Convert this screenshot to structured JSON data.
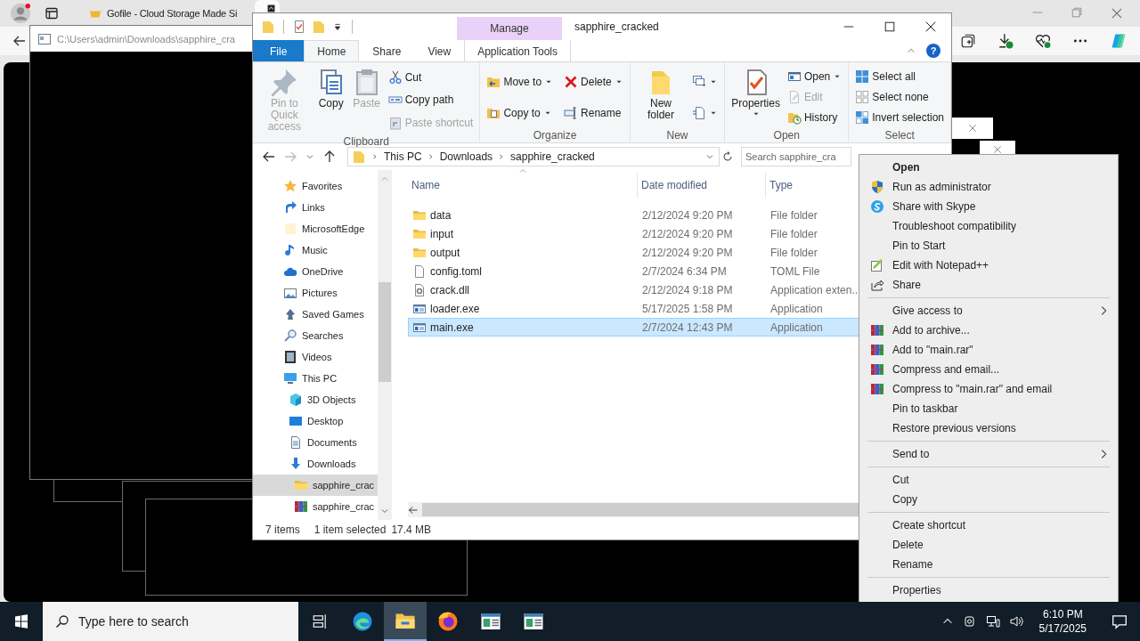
{
  "browser": {
    "tabs": [
      {
        "title": "Gofile - Cloud Storage Made Si",
        "selected": false
      },
      {
        "selected": true
      }
    ]
  },
  "console": {
    "title": "C:\\Users\\admin\\Downloads\\sapphire_cra"
  },
  "explorer": {
    "title": "sapphire_cracked",
    "context_label": "Manage",
    "help": "?",
    "tabs": [
      {
        "label": "File",
        "kind": "file",
        "selected": false
      },
      {
        "label": "Home",
        "kind": "tab",
        "selected": true
      },
      {
        "label": "Share",
        "kind": "tab",
        "selected": false
      },
      {
        "label": "View",
        "kind": "tab",
        "selected": false
      },
      {
        "label": "Application Tools",
        "kind": "context",
        "selected": false
      }
    ],
    "ribbon": [
      {
        "label": "Clipboard",
        "items": [
          {
            "label": "Pin to Quick access",
            "kind": "pin",
            "large": true,
            "disabled": true,
            "dropdown": false
          },
          {
            "label": "Copy",
            "kind": "copy",
            "large": true,
            "disabled": false,
            "dropdown": false
          },
          {
            "label": "Paste",
            "kind": "paste",
            "large": true,
            "disabled": true,
            "dropdown": false
          },
          {
            "label": "Cut",
            "kind": "cut",
            "large": false,
            "disabled": false,
            "dropdown": false
          },
          {
            "label": "Copy path",
            "kind": "copypath",
            "large": false,
            "disabled": false,
            "dropdown": false
          },
          {
            "label": "Paste shortcut",
            "kind": "pasteshortcut",
            "large": false,
            "disabled": true,
            "dropdown": false
          }
        ]
      },
      {
        "label": "Organize",
        "items": [
          {
            "label": "Move to",
            "kind": "moveto",
            "large": false,
            "disabled": false,
            "dropdown": true
          },
          {
            "label": "Copy to",
            "kind": "copyto",
            "large": false,
            "disabled": false,
            "dropdown": true
          },
          {
            "label": "Delete",
            "kind": "delete",
            "large": false,
            "disabled": false,
            "dropdown": true
          },
          {
            "label": "Rename",
            "kind": "rename",
            "large": false,
            "disabled": false,
            "dropdown": false
          }
        ]
      },
      {
        "label": "New",
        "items": [
          {
            "label": "New folder",
            "kind": "newfolder",
            "large": true,
            "disabled": false,
            "dropdown": false
          },
          {
            "kind": "newitem",
            "large": false,
            "disabled": false,
            "dropdown": true
          },
          {
            "kind": "easyaccess",
            "large": false,
            "disabled": false,
            "dropdown": true
          }
        ]
      },
      {
        "label": "Open",
        "items": [
          {
            "label": "Properties",
            "kind": "properties",
            "large": true,
            "disabled": false,
            "dropdown": true
          },
          {
            "label": "Open",
            "kind": "open",
            "large": false,
            "disabled": false,
            "dropdown": true
          },
          {
            "label": "Edit",
            "kind": "edit",
            "large": false,
            "disabled": true,
            "dropdown": false
          },
          {
            "label": "History",
            "kind": "history",
            "large": false,
            "disabled": false,
            "dropdown": false
          }
        ]
      },
      {
        "label": "Select",
        "items": [
          {
            "label": "Select all",
            "kind": "selectall",
            "large": false,
            "disabled": false,
            "dropdown": false
          },
          {
            "label": "Select none",
            "kind": "selectnone",
            "large": false,
            "disabled": false,
            "dropdown": false
          },
          {
            "label": "Invert selection",
            "kind": "invert",
            "large": false,
            "disabled": false,
            "dropdown": false
          }
        ]
      }
    ],
    "path": [
      "This PC",
      "Downloads",
      "sapphire_cracked"
    ],
    "search": {
      "placeholder": "Search sapphire_cra"
    },
    "nav": [
      {
        "label": "Favorites",
        "kind": "star",
        "selected": false
      },
      {
        "label": "Links",
        "kind": "link",
        "selected": false
      },
      {
        "label": "MicrosoftEdge",
        "kind": "blank",
        "selected": false
      },
      {
        "label": "Music",
        "kind": "music",
        "selected": false
      },
      {
        "label": "OneDrive",
        "kind": "cloud",
        "selected": false
      },
      {
        "label": "Pictures",
        "kind": "pictures",
        "selected": false
      },
      {
        "label": "Saved Games",
        "kind": "games",
        "selected": false
      },
      {
        "label": "Searches",
        "kind": "searches",
        "selected": false
      },
      {
        "label": "Videos",
        "kind": "video",
        "selected": false
      },
      {
        "label": "This PC",
        "kind": "pc",
        "selected": false,
        "children": [
          {
            "label": "3D Objects",
            "kind": "cube",
            "selected": false
          },
          {
            "label": "Desktop",
            "kind": "desktop",
            "selected": false
          },
          {
            "label": "Documents",
            "kind": "documents",
            "selected": false
          },
          {
            "label": "Downloads",
            "kind": "download",
            "selected": false,
            "children": [
              {
                "label": "sapphire_crac",
                "kind": "folder",
                "selected": true
              },
              {
                "label": "sapphire_crac",
                "kind": "rar",
                "selected": false
              }
            ]
          }
        ]
      }
    ],
    "columns": [
      {
        "label": "Name",
        "sorted": true
      },
      {
        "label": "Date modified",
        "sorted": false
      },
      {
        "label": "Type",
        "sorted": false
      }
    ],
    "files": [
      {
        "name": "data",
        "date": "2/12/2024 9:20 PM",
        "type": "File folder",
        "kind": "folder",
        "selected": false
      },
      {
        "name": "input",
        "date": "2/12/2024 9:20 PM",
        "type": "File folder",
        "kind": "folder",
        "selected": false
      },
      {
        "name": "output",
        "date": "2/12/2024 9:20 PM",
        "type": "File folder",
        "kind": "folder",
        "selected": false
      },
      {
        "name": "config.toml",
        "date": "2/7/2024 6:34 PM",
        "type": "TOML File",
        "kind": "file",
        "selected": false
      },
      {
        "name": "crack.dll",
        "date": "2/12/2024 9:18 PM",
        "type": "Application exten..",
        "kind": "dll",
        "selected": false
      },
      {
        "name": "loader.exe",
        "date": "5/17/2025 1:58 PM",
        "type": "Application",
        "kind": "exe",
        "selected": false
      },
      {
        "name": "main.exe",
        "date": "2/7/2024 12:43 PM",
        "type": "Application",
        "kind": "exe",
        "selected": true
      }
    ],
    "status": {
      "count": "7 items",
      "selection": "1 item selected",
      "size": "17.4 MB"
    }
  },
  "menu": {
    "groups": [
      [
        {
          "label": "Open",
          "kind": "plain",
          "default": true,
          "submenu": false
        },
        {
          "label": "Run as administrator",
          "kind": "shield",
          "default": false,
          "submenu": false
        },
        {
          "label": "Share with Skype",
          "kind": "skype",
          "default": false,
          "submenu": false
        },
        {
          "label": "Troubleshoot compatibility",
          "kind": "plain",
          "default": false,
          "submenu": false
        },
        {
          "label": "Pin to Start",
          "kind": "plain",
          "default": false,
          "submenu": false
        },
        {
          "label": "Edit with Notepad++",
          "kind": "notepad",
          "default": false,
          "submenu": false
        },
        {
          "label": "Share",
          "kind": "share",
          "default": false,
          "submenu": false
        }
      ],
      [
        {
          "label": "Give access to",
          "kind": "plain",
          "default": false,
          "submenu": true
        },
        {
          "label": "Add to archive...",
          "kind": "rar",
          "default": false,
          "submenu": false
        },
        {
          "label": "Add to \"main.rar\"",
          "kind": "rar",
          "default": false,
          "submenu": false
        },
        {
          "label": "Compress and email...",
          "kind": "rar",
          "default": false,
          "submenu": false
        },
        {
          "label": "Compress to \"main.rar\" and email",
          "kind": "rar",
          "default": false,
          "submenu": false
        },
        {
          "label": "Pin to taskbar",
          "kind": "plain",
          "default": false,
          "submenu": false
        },
        {
          "label": "Restore previous versions",
          "kind": "plain",
          "default": false,
          "submenu": false
        }
      ],
      [
        {
          "label": "Send to",
          "kind": "plain",
          "default": false,
          "submenu": true
        }
      ],
      [
        {
          "label": "Cut",
          "kind": "plain",
          "default": false,
          "submenu": false
        },
        {
          "label": "Copy",
          "kind": "plain",
          "default": false,
          "submenu": false
        }
      ],
      [
        {
          "label": "Create shortcut",
          "kind": "plain",
          "default": false,
          "submenu": false
        },
        {
          "label": "Delete",
          "kind": "plain",
          "default": false,
          "submenu": false
        },
        {
          "label": "Rename",
          "kind": "plain",
          "default": false,
          "submenu": false
        }
      ],
      [
        {
          "label": "Properties",
          "kind": "plain",
          "default": false,
          "submenu": false
        }
      ]
    ]
  },
  "taskbar": {
    "search": {
      "placeholder": "Type here to search"
    },
    "apps": [
      {
        "kind": "taskview",
        "active": false
      },
      {
        "kind": "edge",
        "active": false
      },
      {
        "kind": "explorer",
        "active": true
      },
      {
        "kind": "firefox",
        "active": false
      },
      {
        "kind": "app",
        "active": false
      },
      {
        "kind": "app",
        "active": false
      }
    ],
    "time": "6:10 PM",
    "date": "5/17/2025"
  }
}
